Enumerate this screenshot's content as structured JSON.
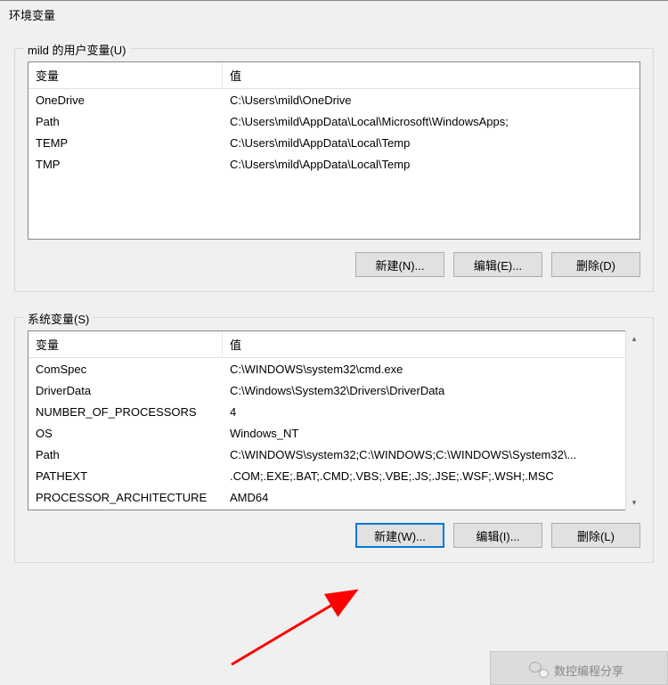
{
  "window": {
    "title": "环境变量"
  },
  "user_section": {
    "legend": "mild 的用户变量(U)",
    "headers": {
      "variable": "变量",
      "value": "值"
    },
    "rows": [
      {
        "variable": "OneDrive",
        "value": "C:\\Users\\mild\\OneDrive"
      },
      {
        "variable": "Path",
        "value": "C:\\Users\\mild\\AppData\\Local\\Microsoft\\WindowsApps;"
      },
      {
        "variable": "TEMP",
        "value": "C:\\Users\\mild\\AppData\\Local\\Temp"
      },
      {
        "variable": "TMP",
        "value": "C:\\Users\\mild\\AppData\\Local\\Temp"
      }
    ],
    "buttons": {
      "new": "新建(N)...",
      "edit": "编辑(E)...",
      "delete": "删除(D)"
    }
  },
  "system_section": {
    "legend": "系统变量(S)",
    "headers": {
      "variable": "变量",
      "value": "值"
    },
    "rows": [
      {
        "variable": "ComSpec",
        "value": "C:\\WINDOWS\\system32\\cmd.exe"
      },
      {
        "variable": "DriverData",
        "value": "C:\\Windows\\System32\\Drivers\\DriverData"
      },
      {
        "variable": "NUMBER_OF_PROCESSORS",
        "value": "4"
      },
      {
        "variable": "OS",
        "value": "Windows_NT"
      },
      {
        "variable": "Path",
        "value": "C:\\WINDOWS\\system32;C:\\WINDOWS;C:\\WINDOWS\\System32\\..."
      },
      {
        "variable": "PATHEXT",
        "value": ".COM;.EXE;.BAT;.CMD;.VBS;.VBE;.JS;.JSE;.WSF;.WSH;.MSC"
      },
      {
        "variable": "PROCESSOR_ARCHITECTURE",
        "value": "AMD64"
      }
    ],
    "buttons": {
      "new": "新建(W)...",
      "edit": "编辑(I)...",
      "delete": "删除(L)"
    }
  },
  "watermark": {
    "text": "数控编程分享"
  }
}
